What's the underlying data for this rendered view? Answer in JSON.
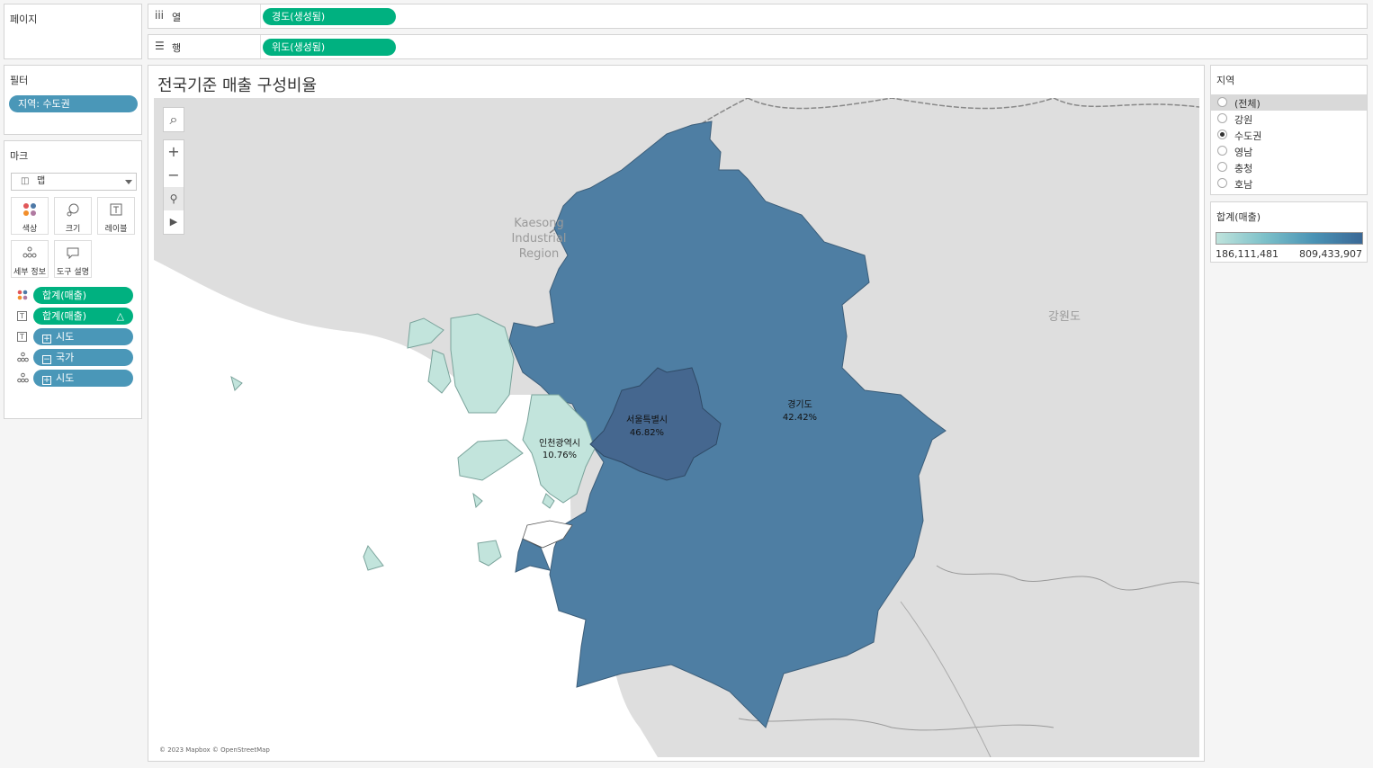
{
  "pages_panel": {
    "title": "페이지"
  },
  "filters_panel": {
    "title": "필터",
    "pill": "지역: 수도권"
  },
  "marks_panel": {
    "title": "마크",
    "mark_type": "맵",
    "buttons": {
      "color": "색상",
      "size": "크기",
      "label": "레이블",
      "detail": "세부 정보",
      "tooltip": "도구 설명"
    },
    "shelf": [
      {
        "label": "합계(매출)",
        "kind": "color"
      },
      {
        "label": "합계(매출)",
        "kind": "label",
        "delta": "△"
      },
      {
        "label": "시도",
        "kind": "label"
      },
      {
        "label": "국가",
        "kind": "detail"
      },
      {
        "label": "시도",
        "kind": "detail"
      }
    ]
  },
  "columns_shelf": {
    "label": "열",
    "pill": "경도(생성됨)"
  },
  "rows_shelf": {
    "label": "행",
    "pill": "위도(생성됨)"
  },
  "sheet": {
    "title": "전국기준 매출 구성비율",
    "attribution": "© 2023 Mapbox © OpenStreetMap",
    "background_labels": {
      "kaesong_1": "Kaesong",
      "kaesong_2": "Industrial",
      "kaesong_3": "Region",
      "gangwon": "강원도"
    },
    "regions": [
      {
        "name": "서울특별시",
        "pct": "46.82%",
        "color": "#45678f"
      },
      {
        "name": "경기도",
        "pct": "42.42%",
        "color": "#4e7ea3"
      },
      {
        "name": "인천광역시",
        "pct": "10.76%",
        "color": "#c2e4dc"
      }
    ]
  },
  "region_filter": {
    "title": "지역",
    "options": [
      {
        "label": "(전체)",
        "selected": false
      },
      {
        "label": "강원",
        "selected": false
      },
      {
        "label": "수도권",
        "selected": true
      },
      {
        "label": "영남",
        "selected": false
      },
      {
        "label": "충청",
        "selected": false
      },
      {
        "label": "호남",
        "selected": false
      }
    ]
  },
  "color_legend": {
    "title": "합계(매출)",
    "min": "186,111,481",
    "max": "809,433,907"
  }
}
